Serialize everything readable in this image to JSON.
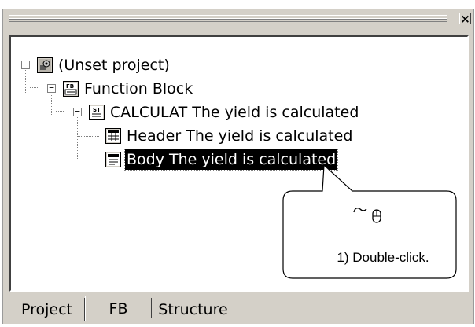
{
  "panel": {
    "close_label": "×"
  },
  "tree": {
    "nodes": [
      {
        "label": "(Unset project)",
        "icon": "project-icon",
        "expanded": true
      },
      {
        "label": "Function Block",
        "icon": "fb-folder-icon",
        "expanded": true
      },
      {
        "label": "CALCULAT The yield is calculated",
        "icon": "st-program-icon",
        "expanded": true
      },
      {
        "label": "Header The yield is calculated",
        "icon": "header-icon"
      },
      {
        "label": "Body The yield is calculated",
        "icon": "body-icon",
        "selected": true
      }
    ]
  },
  "tabs": [
    {
      "label": "Project",
      "active": false
    },
    {
      "label": "FB",
      "active": true
    },
    {
      "label": "Structure",
      "active": false
    }
  ],
  "callout": {
    "icon": "mouse-icon",
    "text": "1) Double-click."
  },
  "colors": {
    "chrome": "#d4d0c8",
    "selection": "#000000",
    "pane": "#ffffff"
  }
}
